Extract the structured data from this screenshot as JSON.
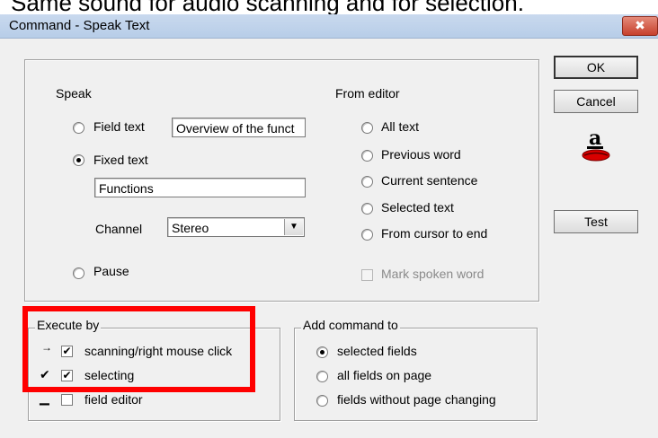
{
  "caption": "Same sound for audio scanning and for selection.",
  "window": {
    "title": "Command - Speak Text",
    "close_glyph": "✖"
  },
  "speak": {
    "label": "Speak",
    "field_text": {
      "label": "Field text",
      "value": "Overview of the funct",
      "selected": false
    },
    "fixed_text": {
      "label": "Fixed text",
      "value": "Functions",
      "selected": true
    },
    "channel": {
      "label": "Channel",
      "value": "Stereo"
    },
    "pause": {
      "label": "Pause",
      "selected": false
    }
  },
  "from_editor": {
    "label": "From editor",
    "options": [
      {
        "label": "All text",
        "selected": false
      },
      {
        "label": "Previous word",
        "selected": false
      },
      {
        "label": "Current sentence",
        "selected": false
      },
      {
        "label": "Selected text",
        "selected": false
      },
      {
        "label": "From cursor to end",
        "selected": false
      }
    ],
    "mark_spoken_word": {
      "label": "Mark spoken word",
      "checked": false,
      "enabled": false
    }
  },
  "execute_by": {
    "label": "Execute by",
    "items": [
      {
        "indicator": "→",
        "label": "scanning/right mouse click",
        "checked": true
      },
      {
        "indicator": "✔",
        "label": "selecting",
        "checked": true
      },
      {
        "indicator": "▁",
        "label": "field editor",
        "checked": false
      }
    ]
  },
  "add_command_to": {
    "label": "Add command to",
    "options": [
      {
        "label": "selected fields",
        "selected": true
      },
      {
        "label": "all fields on page",
        "selected": false
      },
      {
        "label": "fields without page changing",
        "selected": false
      }
    ]
  },
  "buttons": {
    "ok": "OK",
    "cancel": "Cancel",
    "test": "Test"
  },
  "icons": {
    "speak_icon_letter": "a",
    "highlight_color": "#ff0000"
  }
}
